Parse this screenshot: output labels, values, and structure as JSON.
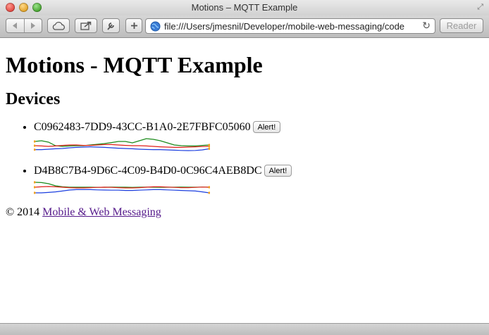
{
  "window": {
    "title": "Motions – MQTT Example"
  },
  "toolbar": {
    "url": "file:///Users/jmesnil/Developer/mobile-web-messaging/code",
    "reader_label": "Reader"
  },
  "page": {
    "heading": "Motions - MQTT Example",
    "subheading": "Devices",
    "devices": [
      {
        "id": "C0962483-7DD9-43CC-B1A0-2E7FBFC05060",
        "alert_label": "Alert!",
        "series": {
          "green": [
            0.3,
            0.25,
            0.35,
            0.6,
            0.65,
            0.62,
            0.6,
            0.6,
            0.55,
            0.5,
            0.45,
            0.38,
            0.3,
            0.3,
            0.4,
            0.25,
            0.1,
            0.15,
            0.25,
            0.4,
            0.55,
            0.6,
            0.62,
            0.62,
            0.58,
            0.55
          ],
          "red": [
            0.6,
            0.62,
            0.65,
            0.62,
            0.58,
            0.55,
            0.55,
            0.58,
            0.58,
            0.55,
            0.52,
            0.52,
            0.55,
            0.58,
            0.6,
            0.6,
            0.62,
            0.65,
            0.68,
            0.7,
            0.72,
            0.72,
            0.7,
            0.68,
            0.66,
            0.65
          ],
          "blue": [
            0.88,
            0.88,
            0.85,
            0.82,
            0.8,
            0.75,
            0.72,
            0.7,
            0.68,
            0.7,
            0.72,
            0.75,
            0.78,
            0.8,
            0.82,
            0.85,
            0.87,
            0.88,
            0.88,
            0.9,
            0.92,
            0.94,
            0.95,
            0.94,
            0.9,
            0.82
          ]
        }
      },
      {
        "id": "D4B8C7B4-9D6C-4C09-B4D0-0C96C4AEB8DC",
        "alert_label": "Alert!",
        "series": {
          "green": [
            0.1,
            0.12,
            0.2,
            0.35,
            0.42,
            0.45,
            0.45,
            0.45,
            0.45,
            0.46,
            0.45,
            0.44,
            0.45,
            0.45,
            0.46,
            0.45,
            0.44,
            0.45,
            0.46,
            0.45,
            0.45,
            0.44,
            0.45,
            0.45,
            0.44,
            0.45
          ],
          "red": [
            0.45,
            0.42,
            0.4,
            0.42,
            0.45,
            0.48,
            0.5,
            0.5,
            0.48,
            0.46,
            0.45,
            0.46,
            0.48,
            0.5,
            0.5,
            0.48,
            0.45,
            0.42,
            0.42,
            0.44,
            0.46,
            0.48,
            0.48,
            0.46,
            0.44,
            0.45
          ],
          "blue": [
            0.85,
            0.85,
            0.82,
            0.78,
            0.72,
            0.65,
            0.62,
            0.62,
            0.62,
            0.64,
            0.65,
            0.66,
            0.66,
            0.68,
            0.68,
            0.66,
            0.64,
            0.62,
            0.62,
            0.64,
            0.66,
            0.68,
            0.7,
            0.72,
            0.78,
            0.85
          ]
        }
      }
    ],
    "footer": {
      "copyright": "© 2014",
      "link_text": "Mobile & Web Messaging"
    }
  },
  "colors": {
    "green": "#1a8a1a",
    "red": "#e0201a",
    "blue": "#1a3ee0",
    "marker": "#f0a020"
  }
}
